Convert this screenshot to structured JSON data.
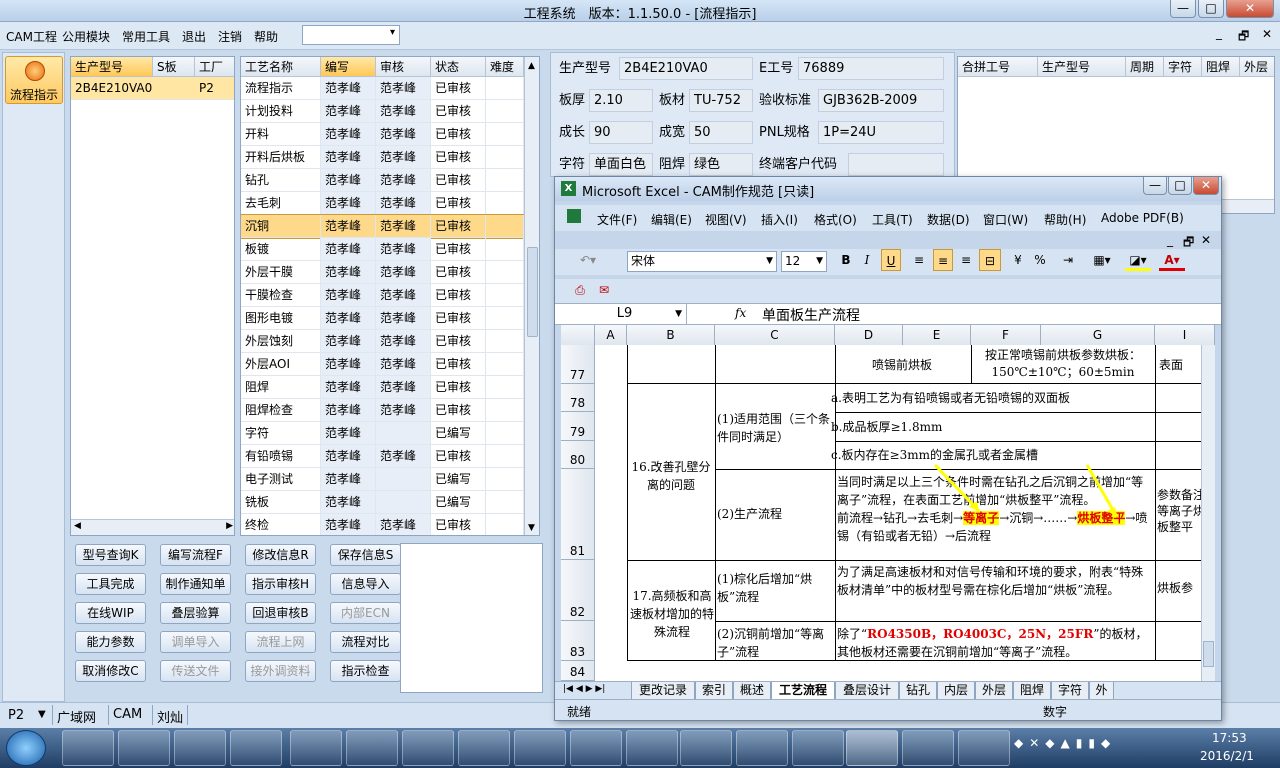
{
  "window": {
    "title": "工程系统　版本：1.1.50.0 - [流程指示]",
    "controls": [
      "—",
      "□",
      "✕"
    ],
    "mdi_controls": [
      "_",
      "🗗",
      "✕"
    ]
  },
  "menu": [
    "CAM工程",
    "公用模块",
    "常用工具",
    "退出",
    "注销",
    "帮助"
  ],
  "leftnav": {
    "button": "流程指示"
  },
  "model_grid": {
    "headers": [
      "生产型号",
      "S板",
      "工厂"
    ],
    "rows": [
      [
        "2B4E210VA0",
        "",
        "P2"
      ]
    ]
  },
  "process_grid": {
    "headers": [
      "工艺名称",
      "编写",
      "审核",
      "状态",
      "难度"
    ],
    "rows": [
      [
        "流程指示",
        "范孝峰",
        "范孝峰",
        "已审核"
      ],
      [
        "计划投料",
        "范孝峰",
        "范孝峰",
        "已审核"
      ],
      [
        "开料",
        "范孝峰",
        "范孝峰",
        "已审核"
      ],
      [
        "开料后烘板",
        "范孝峰",
        "范孝峰",
        "已审核"
      ],
      [
        "钻孔",
        "范孝峰",
        "范孝峰",
        "已审核"
      ],
      [
        "去毛刺",
        "范孝峰",
        "范孝峰",
        "已审核"
      ],
      [
        "沉铜",
        "范孝峰",
        "范孝峰",
        "已审核"
      ],
      [
        "板镀",
        "范孝峰",
        "范孝峰",
        "已审核"
      ],
      [
        "外层干膜",
        "范孝峰",
        "范孝峰",
        "已审核"
      ],
      [
        "干膜检查",
        "范孝峰",
        "范孝峰",
        "已审核"
      ],
      [
        "图形电镀",
        "范孝峰",
        "范孝峰",
        "已审核"
      ],
      [
        "外层蚀刻",
        "范孝峰",
        "范孝峰",
        "已审核"
      ],
      [
        "外层AOI",
        "范孝峰",
        "范孝峰",
        "已审核"
      ],
      [
        "阻焊",
        "范孝峰",
        "范孝峰",
        "已审核"
      ],
      [
        "阻焊检查",
        "范孝峰",
        "范孝峰",
        "已审核"
      ],
      [
        "字符",
        "范孝峰",
        "",
        "已编写"
      ],
      [
        "有铅喷锡",
        "范孝峰",
        "范孝峰",
        "已审核"
      ],
      [
        "电子测试",
        "范孝峰",
        "",
        "已编写"
      ],
      [
        "铣板",
        "范孝峰",
        "",
        "已编写"
      ],
      [
        "终检",
        "范孝峰",
        "范孝峰",
        "已审核"
      ]
    ],
    "selected_row": 6
  },
  "actions": [
    [
      "型号查询K",
      "编写流程F",
      "修改信息R",
      "保存信息S"
    ],
    [
      "工具完成",
      "制作通知单",
      "指示审核H",
      "信息导入"
    ],
    [
      "在线WIP",
      "叠层验算",
      "回退审核B",
      "内部ECN"
    ],
    [
      "能力参数",
      "调单导入",
      "流程上网",
      "流程对比"
    ],
    [
      "取消修改C",
      "传送文件",
      "接外调资料",
      "指示检查"
    ]
  ],
  "disabled_actions": [
    "内部ECN",
    "调单导入",
    "流程上网",
    "传送文件",
    "接外调资料"
  ],
  "info": {
    "生产型号": "2B4E210VA0",
    "E工号": "76889",
    "板厚": "2.10",
    "板材": "TU-752",
    "验收标准": "GJB362B-2009",
    "成长": "90",
    "成宽": "50",
    "PNL规格": "1P=24U",
    "字符": "单面白色",
    "阻焊": "绿色",
    "终端客户代码": ""
  },
  "panel_grid_headers": [
    "合拼工号",
    "生产型号",
    "周期",
    "字符",
    "阻焊",
    "外层"
  ],
  "statusbar": [
    "P2",
    "广域网",
    "CAM",
    "刘灿"
  ],
  "excel": {
    "title": "Microsoft Excel - CAM制作规范  [只读]",
    "menu": [
      "文件(F)",
      "编辑(E)",
      "视图(V)",
      "插入(I)",
      "格式(O)",
      "工具(T)",
      "数据(D)",
      "窗口(W)",
      "帮助(H)",
      "Adobe PDF(B)"
    ],
    "font": "宋体",
    "size": "12",
    "cell_ref": "L9",
    "fx": "fx",
    "formula": "单面板生产流程",
    "columns": [
      "A",
      "B",
      "C",
      "D",
      "E",
      "F",
      "G",
      "I"
    ],
    "rows": [
      "77",
      "78",
      "79",
      "80",
      "81",
      "82",
      "83",
      "84"
    ],
    "cells": {
      "d77": "喷锡前烘板",
      "f77": "按正常喷锡前烘板参数烘板：150℃±10℃；60±5min",
      "i77": "表面",
      "b80": "16.改善孔壁分离的问题",
      "c79": "(1)适用范围（三个条件同时满足）",
      "d78": "a.表明工艺为有铅喷锡或者无铅喷锡的双面板",
      "d79": "b.成品板厚≥1.8mm",
      "d80": "c.板内存在≥3mm的金属孔或者金属槽",
      "c81": "(2)生产流程",
      "d81a": "当同时满足以上三个条件时需在钻孔之后沉铜之前增加“等离子”流程，在表面工艺前增加“烘板整平”流程。",
      "d81b": "前流程→钻孔→去毛刺→",
      "d81c": "等离子",
      "d81d": "→沉铜→……→",
      "d81e": "烘板整平",
      "d81f": "→喷锡（有铅或者无铅）→后流程",
      "i81": "参数备注等离子烘板整平",
      "b82": "17.高频板和高速板材增加的特殊流程",
      "c82": "(1)棕化后增加“烘板”流程",
      "d82": "为了满足高速板材和对信号传输和环境的要求，附表“特殊板材清单”中的板材型号需在棕化后增加“烘板”流程。",
      "i82": "烘板参",
      "c83": "(2)沉铜前增加“等离子”流程",
      "d83a": "除了“",
      "d83b": "RO4350B，RO4003C，25N，25FR",
      "d83c": "”的板材，其他板材还需要在沉铜前增加“等离子”流程。"
    },
    "tabs": [
      "更改记录",
      "索引",
      "概述",
      "工艺流程",
      "叠层设计",
      "钻孔",
      "内层",
      "外层",
      "阻焊",
      "字符",
      "外"
    ],
    "active_tab": "工艺流程",
    "status_left": "就绪",
    "status_right": "数字"
  },
  "clock": {
    "time": "17:53",
    "date": "2016/2/1"
  }
}
